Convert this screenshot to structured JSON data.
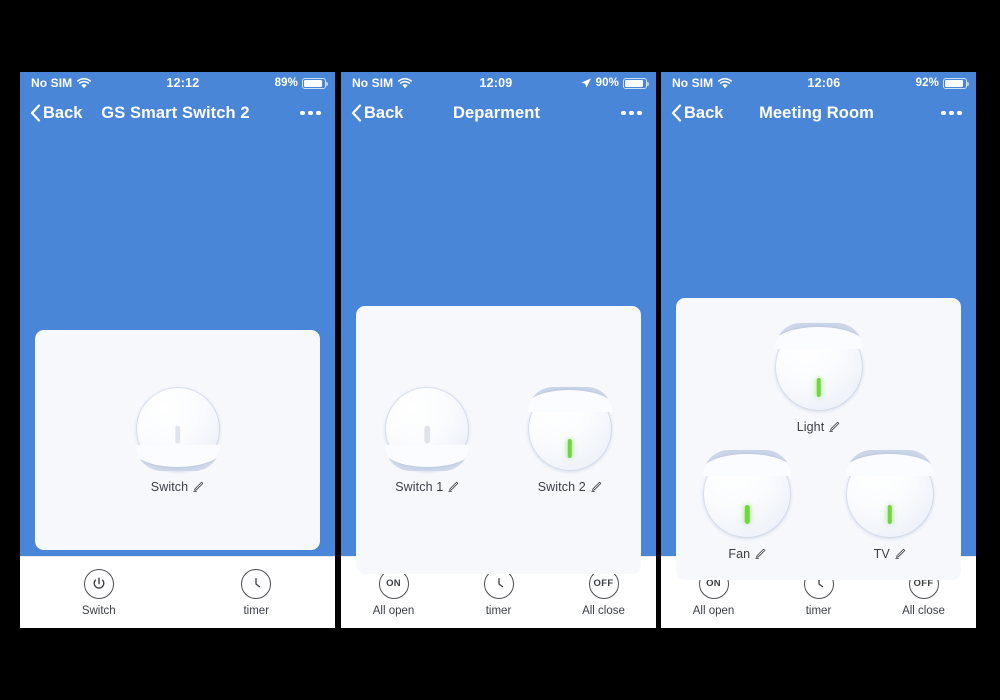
{
  "phones": [
    {
      "id": "phone-1",
      "status": {
        "carrier": "No SIM",
        "time": "12:12",
        "battery_pct": "89%",
        "has_location": false
      },
      "nav": {
        "back_label": "Back",
        "title": "GS Smart Switch 2",
        "more_label": "More options"
      },
      "card": {
        "layout": "one",
        "knobs": [
          {
            "label": "Switch",
            "state": "off"
          }
        ]
      },
      "toolbar": [
        {
          "icon": "power-icon",
          "glyph": "",
          "label": "Switch"
        },
        {
          "icon": "clock-icon",
          "glyph": "",
          "label": "timer"
        }
      ]
    },
    {
      "id": "phone-2",
      "status": {
        "carrier": "No SIM",
        "time": "12:09",
        "battery_pct": "90%",
        "has_location": true
      },
      "nav": {
        "back_label": "Back",
        "title": "Deparment",
        "more_label": "More options"
      },
      "card": {
        "layout": "two",
        "knobs": [
          {
            "label": "Switch 1",
            "state": "off"
          },
          {
            "label": "Switch 2",
            "state": "on"
          }
        ]
      },
      "toolbar": [
        {
          "icon": "on-icon",
          "glyph": "ON",
          "label": "All open"
        },
        {
          "icon": "clock-icon",
          "glyph": "",
          "label": "timer"
        },
        {
          "icon": "off-icon",
          "glyph": "OFF",
          "label": "All close"
        }
      ]
    },
    {
      "id": "phone-3",
      "status": {
        "carrier": "No SIM",
        "time": "12:06",
        "battery_pct": "92%",
        "has_location": false
      },
      "nav": {
        "back_label": "Back",
        "title": "Meeting Room",
        "more_label": "More options"
      },
      "card": {
        "layout": "three",
        "knobs": [
          {
            "label": "Light",
            "state": "on"
          },
          {
            "label": "Fan",
            "state": "on"
          },
          {
            "label": "TV",
            "state": "on"
          }
        ]
      },
      "toolbar": [
        {
          "icon": "on-icon",
          "glyph": "ON",
          "label": "All open"
        },
        {
          "icon": "clock-icon",
          "glyph": "",
          "label": "timer"
        },
        {
          "icon": "off-icon",
          "glyph": "OFF",
          "label": "All close"
        }
      ]
    }
  ],
  "colors": {
    "accent_blue": "#4a86d8",
    "card_bg": "#f6f8fc",
    "led_on_green": "#6ed73c",
    "led_off_gray": "#dfe3ea",
    "toolbar_bg": "#ffffff",
    "page_bg": "#000000"
  }
}
